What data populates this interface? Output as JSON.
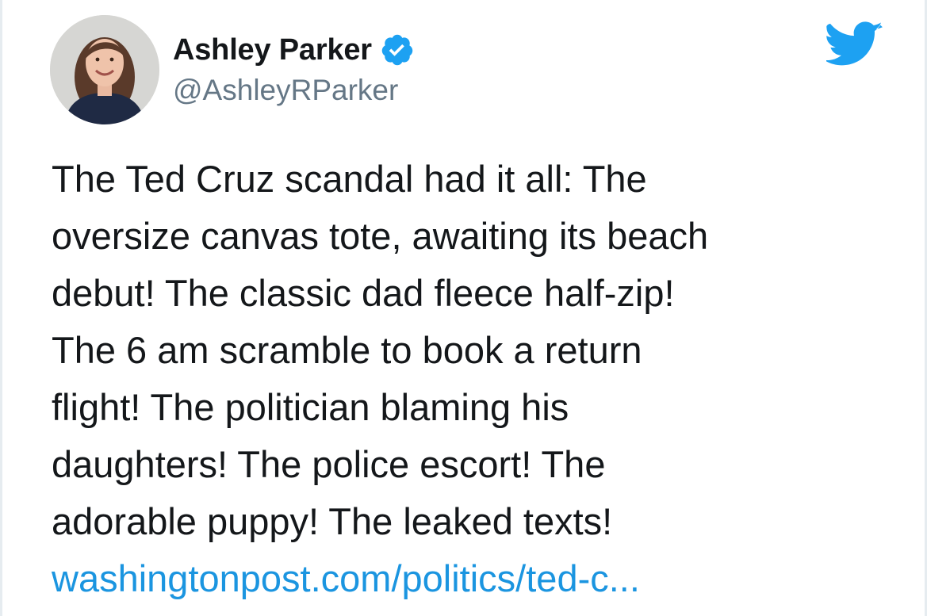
{
  "author": {
    "display_name": "Ashley Parker",
    "handle": "@AshleyRParker",
    "verified": true,
    "avatar": "profile-photo"
  },
  "brand": {
    "icon": "twitter-bird-icon",
    "color": "#1da1f2"
  },
  "tweet": {
    "lines": [
      "The Ted Cruz scandal had it all: The",
      "oversize canvas tote, awaiting its beach",
      "debut! The classic dad fleece half-zip!",
      "The 6 am scramble to book a return",
      "flight! The politician blaming his",
      "daughters! The police escort! The",
      "adorable puppy! The leaked texts!"
    ],
    "link": "washingtonpost.com/politics/ted-c..."
  },
  "colors": {
    "text": "#14171a",
    "secondary": "#657786",
    "link": "#1b95e0",
    "verified": "#1da1f2"
  }
}
